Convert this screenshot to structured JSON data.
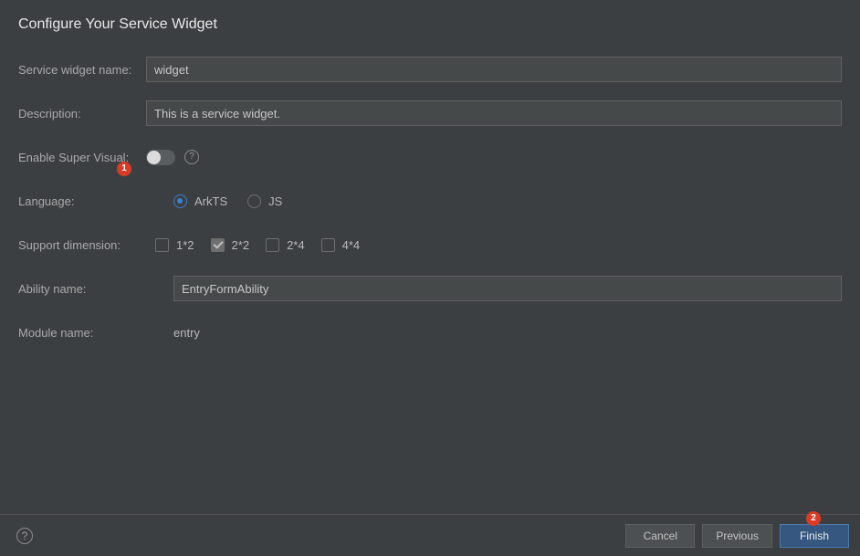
{
  "title": "Configure Your Service Widget",
  "fields": {
    "widgetName": {
      "label": "Service widget name:",
      "value": "widget"
    },
    "description": {
      "label": "Description:",
      "value": "This is a service widget."
    },
    "superVisual": {
      "label": "Enable Super Visual:",
      "enabled": false
    },
    "language": {
      "label": "Language:",
      "options": [
        {
          "label": "ArkTS",
          "selected": true
        },
        {
          "label": "JS",
          "selected": false
        }
      ]
    },
    "dimension": {
      "label": "Support dimension:",
      "options": [
        {
          "label": "1*2",
          "checked": false
        },
        {
          "label": "2*2",
          "checked": true
        },
        {
          "label": "2*4",
          "checked": false
        },
        {
          "label": "4*4",
          "checked": false
        }
      ]
    },
    "abilityName": {
      "label": "Ability name:",
      "value": "EntryFormAbility"
    },
    "moduleName": {
      "label": "Module name:",
      "value": "entry"
    }
  },
  "markers": {
    "one": "1",
    "two": "2"
  },
  "footer": {
    "cancel": "Cancel",
    "previous": "Previous",
    "finish": "Finish"
  }
}
